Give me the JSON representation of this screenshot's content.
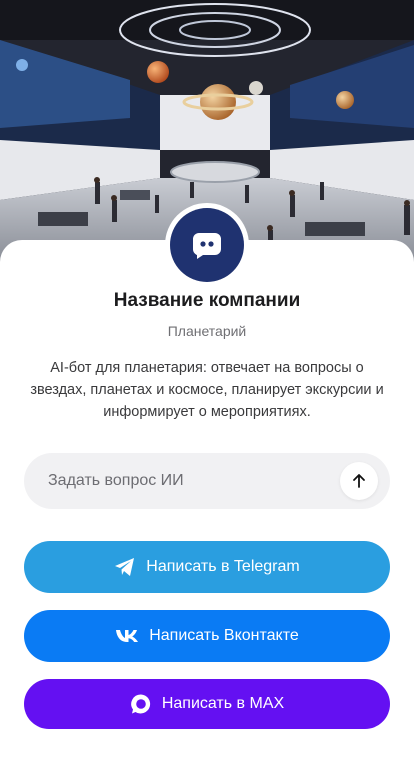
{
  "company": {
    "name": "Название компании",
    "type": "Планетарий",
    "description": "AI-бот для планетария: отвечает на вопросы о звездах, планетах и космосе, планирует экскурсии и информирует о мероприятиях."
  },
  "ask": {
    "placeholder": "Задать вопрос ИИ",
    "send_icon": "arrow-up-icon"
  },
  "buttons": {
    "telegram": {
      "label": "Написать в Telegram",
      "color": "#2a9ee0",
      "icon": "telegram-icon"
    },
    "vk": {
      "label": "Написать Вконтакте",
      "color": "#0a7bf4",
      "icon": "vk-icon"
    },
    "max": {
      "label": "Написать в MAX",
      "color": "#6410f2",
      "icon": "max-icon"
    }
  },
  "colors": {
    "avatar_bg": "#1f3270"
  }
}
